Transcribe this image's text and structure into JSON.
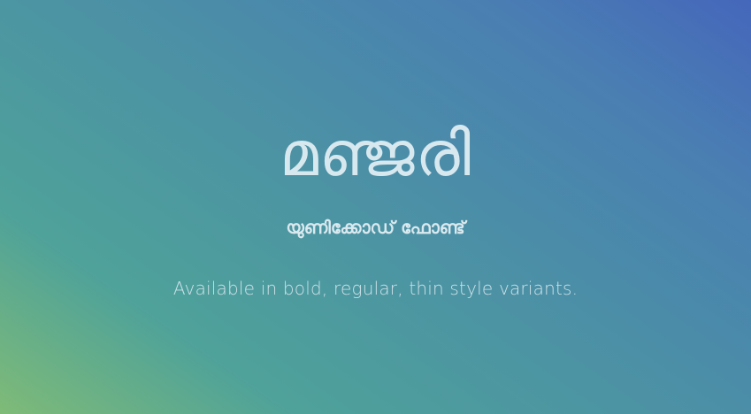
{
  "hero": {
    "title": "മഞ്ജരി",
    "subtitle": "യുണിക്കോഡ് ഫോണ്ട്",
    "tagline": "Available in bold, regular, thin style variants."
  },
  "colors": {
    "gradient_start": "#7fbb77",
    "gradient_mid": "#4fa29a",
    "gradient_end": "#4567bb",
    "text": "#d8e8ef"
  }
}
